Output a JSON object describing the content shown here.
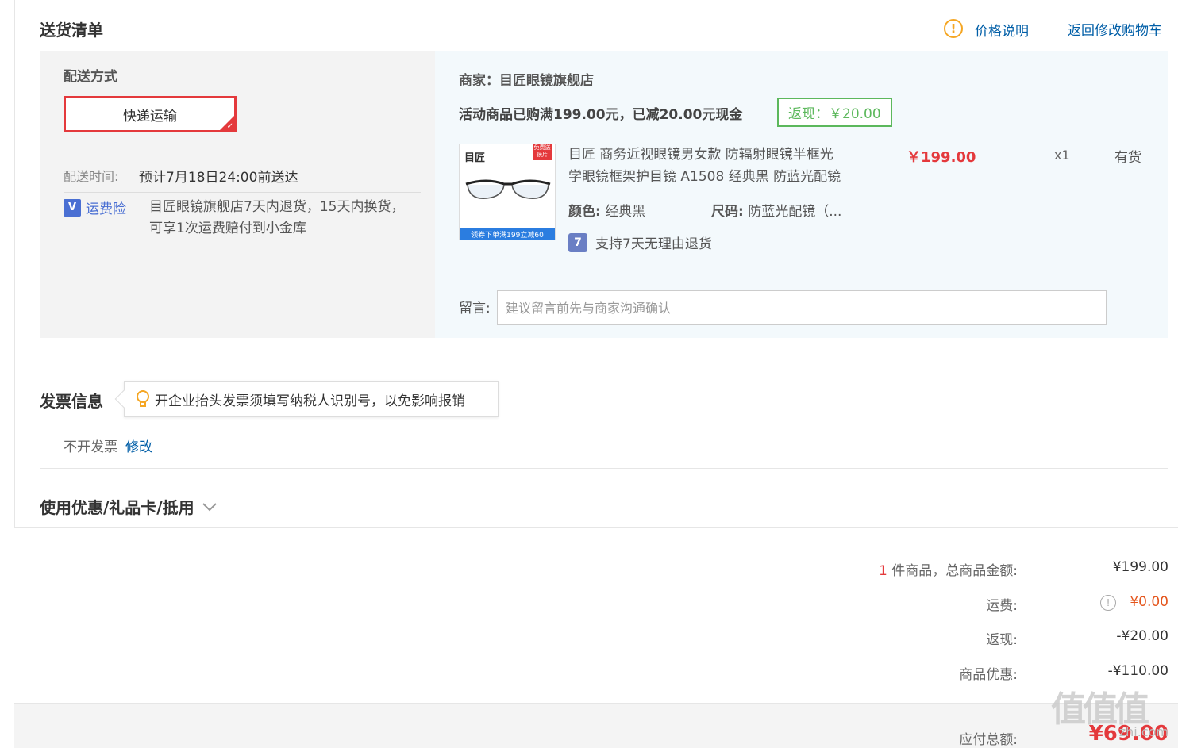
{
  "delivery": {
    "title": "送货清单",
    "price_note": "价格说明",
    "back_to_cart": "返回修改购物车",
    "method_label": "配送方式",
    "method_option": "快递运输",
    "time_label": "配送时间:",
    "time_value": "预计7月18日24:00前送达",
    "insurance_badge": "运费险",
    "insurance_line1": "目匠眼镜旗舰店7天内退货，15天内换货，",
    "insurance_line2": "可享1次运费赔付到小金库"
  },
  "shop": {
    "merchant": "商家：目匠眼镜旗舰店",
    "promo": "活动商品已购满199.00元，已减20.00元现金",
    "rebate": "返现：￥20.00",
    "product": {
      "img_brand": "目匠",
      "img_ribbon": "免费送镜片",
      "img_banner": "领券下单满199立减60",
      "title_line1": "目匠 商务近视眼镜男女款 防辐射眼镜半框光",
      "title_line2": "学眼镜框架护目镜 A1508 经典黑 防蓝光配镜",
      "price": "￥199.00",
      "qty": "x1",
      "stock": "有货",
      "color_label": "颜色:",
      "color_value": "经典黑",
      "size_label": "尺码:",
      "size_value": "防蓝光配镜（...",
      "return_badge": "7",
      "return_text": "支持7天无理由退货"
    },
    "message_label": "留言:",
    "message_placeholder": "建议留言前先与商家沟通确认"
  },
  "invoice": {
    "title": "发票信息",
    "tip": "开企业抬头发票须填写纳税人识别号，以免影响报销",
    "status": "不开发票",
    "edit": "修改"
  },
  "coupon": {
    "title": "使用优惠/礼品卡/抵用"
  },
  "summary": {
    "count": "1",
    "count_label": "件商品，总商品金额:",
    "total_goods": "¥199.00",
    "shipping_label": "运费:",
    "shipping_value": "¥0.00",
    "rebate_label": "返现:",
    "rebate_value": "-¥20.00",
    "discount_label": "商品优惠:",
    "discount_value": "-¥110.00",
    "payable_label": "应付总额:",
    "payable_value": "¥69.00"
  },
  "watermark": {
    "glyphs": "值值值",
    "site": "zhi.com"
  },
  "colors": {
    "accent_red": "#e4393c",
    "link_blue": "#005ea7",
    "rebate_green": "#5cb85c",
    "warn_orange": "#f5a623",
    "shipping_orange": "#e4541b"
  }
}
